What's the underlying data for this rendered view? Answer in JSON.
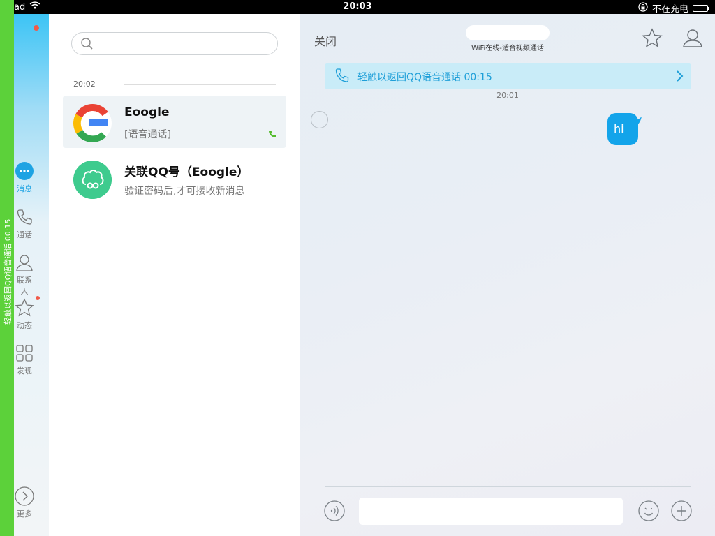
{
  "status_bar": {
    "carrier": "ad",
    "time": "20:03",
    "charging": "不在充电"
  },
  "call_strip": {
    "text": "轻触以返回QQ语音通话 00:15"
  },
  "nav": {
    "items": [
      {
        "label": "消息",
        "icon": "message-bubble-icon",
        "active": true
      },
      {
        "label": "通话",
        "icon": "phone-icon",
        "active": false
      },
      {
        "label": "联系人",
        "icon": "contact-person-icon",
        "active": false
      },
      {
        "label": "动态",
        "icon": "star-icon",
        "active": false,
        "badge": true
      },
      {
        "label": "发现",
        "icon": "grid-icon",
        "active": false
      }
    ],
    "more_label": "更多"
  },
  "conversation_list": {
    "search_placeholder": "",
    "separator_time": "20:02",
    "items": [
      {
        "name": "Eoogle",
        "preview": "[语音通话]",
        "selected": true
      },
      {
        "name": "关联QQ号（Eoogle）",
        "preview": "验证密码后,才可接收新消息",
        "selected": false
      }
    ]
  },
  "chat": {
    "close_label": "关闭",
    "subtitle": "WiFi在线-适合视频通话",
    "banner_text": "轻触以返回QQ语音通话 00:15",
    "message_time": "20:01",
    "messages": [
      {
        "text": "hi",
        "outgoing": true
      }
    ],
    "input_placeholder": ""
  },
  "colors": {
    "accent": "#13a4ea",
    "call_green": "#5cd13a",
    "badge_red": "#f05a4a"
  }
}
